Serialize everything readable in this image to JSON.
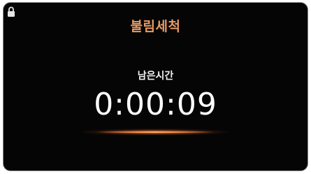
{
  "screen": {
    "title": "불림세척",
    "lock_icon": "lock-icon",
    "label": "남은시간",
    "time": "0:00:09"
  },
  "colors": {
    "background": "#050505",
    "title": "#e89b62",
    "text": "#ffffff",
    "glow": "#ff9a55"
  }
}
